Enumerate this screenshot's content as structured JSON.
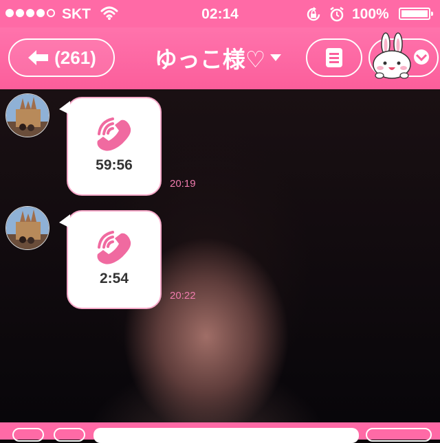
{
  "status_bar": {
    "carrier": "SKT",
    "signal_bars": 4,
    "signal_max": 5,
    "time": "02:14",
    "battery": "100%",
    "icons": [
      "signal-dots-icon",
      "wifi-icon",
      "orientation-lock-icon",
      "alarm-icon",
      "battery-icon"
    ]
  },
  "nav": {
    "back_label": "(261)",
    "title": "ゆっこ様♡",
    "icons": [
      "back-arrow-icon",
      "title-caret-icon",
      "menu-icon",
      "bunny-sticker-icon",
      "chevron-down-icon"
    ]
  },
  "colors": {
    "brand_pink": "#ff6aa6",
    "bubble_border": "#f7a9c9",
    "call_icon": "#f06aa0",
    "timestamp": "#f07cae"
  },
  "messages": [
    {
      "type": "call",
      "icon": "phone-call-icon",
      "duration": "59:56",
      "time": "20:19"
    },
    {
      "type": "call",
      "icon": "phone-call-icon",
      "duration": "2:54",
      "time": "20:22"
    }
  ]
}
